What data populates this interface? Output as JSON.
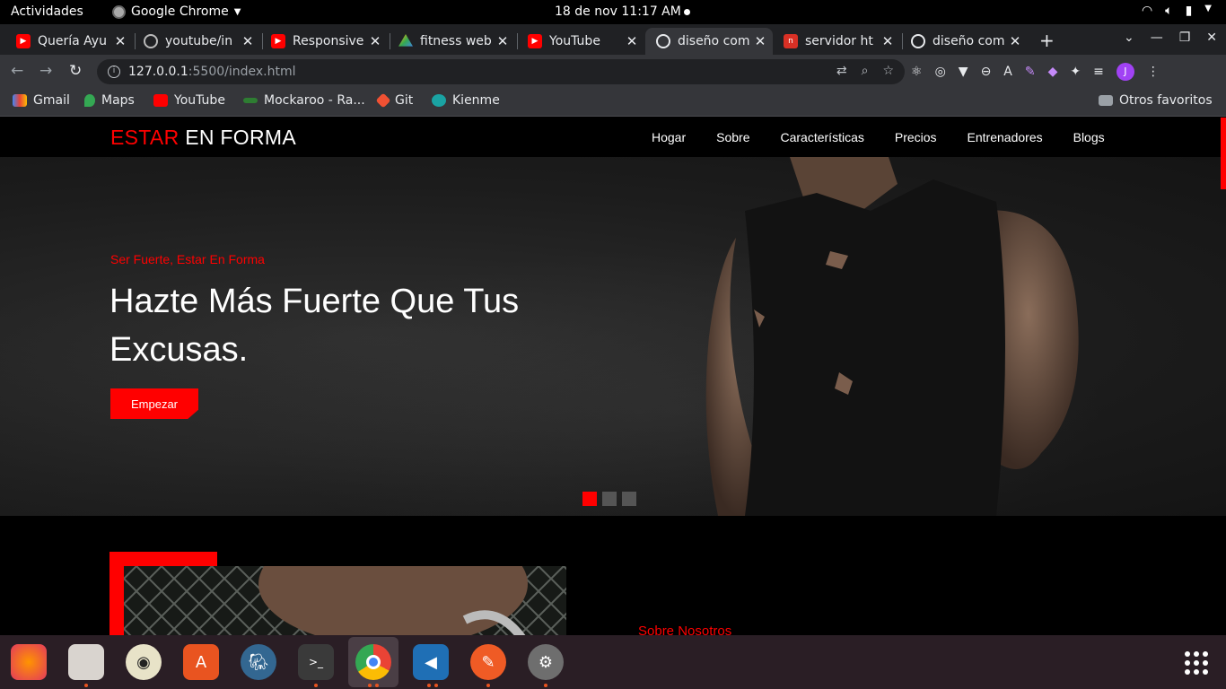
{
  "system": {
    "activities": "Actividades",
    "app_name": "Google Chrome",
    "clock": "18 de nov  11:17 AM"
  },
  "tabs": [
    {
      "title": "Quería Ayu",
      "favicon": "youtube-icon"
    },
    {
      "title": "youtube/in",
      "favicon": "github-icon"
    },
    {
      "title": "Responsive",
      "favicon": "youtube-icon"
    },
    {
      "title": "fitness web",
      "favicon": "drive-icon"
    },
    {
      "title": "YouTube",
      "favicon": "youtube-icon"
    },
    {
      "title": "diseño com",
      "favicon": "globe-icon",
      "active": true
    },
    {
      "title": "servidor ht",
      "favicon": "n-icon"
    },
    {
      "title": "diseño com",
      "favicon": "globe-icon"
    }
  ],
  "address": {
    "host": "127.0.0.1",
    "path": ":5500/index.html"
  },
  "bookmarks": [
    {
      "label": "Gmail",
      "icon": "gmail-icon",
      "color": "#ea4335"
    },
    {
      "label": "Maps",
      "icon": "maps-icon",
      "color": "#34a853"
    },
    {
      "label": "YouTube",
      "icon": "youtube-icon",
      "color": "#ff0000"
    },
    {
      "label": "Mockaroo - Ra...",
      "icon": "mockaroo-icon",
      "color": "#2e7d32"
    },
    {
      "label": "Git",
      "icon": "git-icon",
      "color": "#f05133"
    },
    {
      "label": "Kienme",
      "icon": "kienme-icon",
      "color": "#1aa3a3"
    }
  ],
  "other_bookmarks": "Otros favoritos",
  "site": {
    "brand_red": "ESTAR",
    "brand_white": "EN FORMA",
    "nav": [
      "Hogar",
      "Sobre",
      "Características",
      "Precios",
      "Entrenadores",
      "Blogs"
    ],
    "hero": {
      "subtitle": "Ser Fuerte, Estar En Forma",
      "headline": "Hazte Más Fuerte Que Tus Excusas.",
      "cta": "Empezar",
      "active_slide": 1,
      "slide_count": 3
    },
    "about_label": "Sobre Nosotros",
    "accent": "#ff0000"
  },
  "dock": [
    {
      "name": "firefox-icon"
    },
    {
      "name": "files-icon"
    },
    {
      "name": "rhythmbox-icon"
    },
    {
      "name": "software-center-icon"
    },
    {
      "name": "postgresql-icon"
    },
    {
      "name": "terminal-icon"
    },
    {
      "name": "chrome-icon"
    },
    {
      "name": "vscode-icon"
    },
    {
      "name": "postman-icon"
    },
    {
      "name": "settings-icon"
    }
  ],
  "avatar_initial": "J"
}
